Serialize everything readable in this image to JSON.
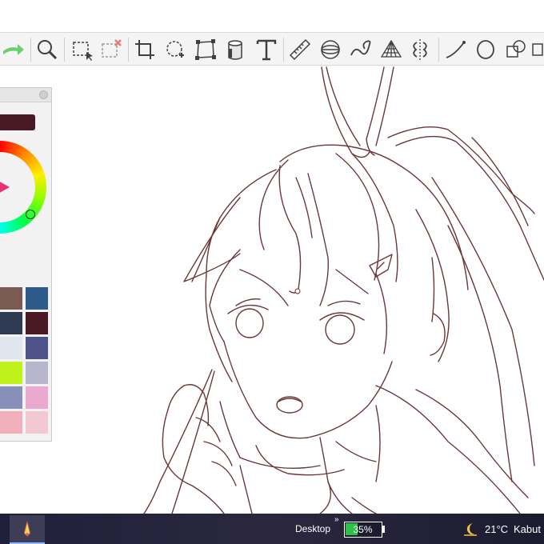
{
  "toolbar": {
    "tools": [
      "redo",
      "zoom",
      "select-rect",
      "deselect",
      "crop",
      "lasso-transform",
      "free-transform",
      "fill-bucket",
      "text",
      "ruler",
      "ellipse-guide",
      "curve-guide",
      "perspective-grid",
      "symmetry",
      "stroke-line",
      "ellipse",
      "layers-copy",
      "more"
    ]
  },
  "color_panel": {
    "current_color": "#4a1a24",
    "wheel_handle_color": "#e8326b",
    "swatches": [
      "#7a5a52",
      "#2e5a8a",
      "#2e3a52",
      "#4a1a24",
      "#e0e6ee",
      "#4e5288",
      "#bff21a",
      "#b8b6cc",
      "#8690b8",
      "#eaaad0",
      "#f0b0bc",
      "#f2c8d2"
    ]
  },
  "taskbar": {
    "desktop_label": "Desktop",
    "chevron": "»",
    "battery_percent": 35,
    "battery_text": "35%",
    "weather_temp": "21°C",
    "weather_desc": "Kabut"
  },
  "colors": {
    "line_art": "#6b3838",
    "toolbar_bg": "#f4f4f4",
    "icon": "#404040",
    "battery_fill": "#2fbf4a"
  }
}
